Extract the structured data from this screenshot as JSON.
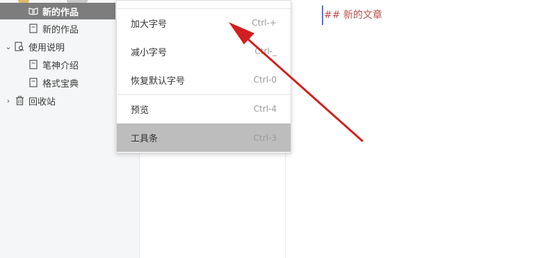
{
  "sidebar": {
    "items": [
      {
        "label": "新的作品",
        "icon": "book-open-icon",
        "selected": true
      },
      {
        "label": "新的作品",
        "icon": "document-icon"
      },
      {
        "label": "使用说明",
        "icon": "search-document-icon",
        "expanded": true
      },
      {
        "label": "笔神介绍",
        "icon": "document-icon"
      },
      {
        "label": "格式宝典",
        "icon": "document-icon"
      },
      {
        "label": "回收站",
        "icon": "trash-icon",
        "expanded": false
      }
    ]
  },
  "menu": {
    "items": [
      {
        "label": "加大字号",
        "shortcut": "Ctrl-+"
      },
      {
        "label": "减小字号",
        "shortcut": "Ctrl-_"
      },
      {
        "label": "恢复默认字号",
        "shortcut": "Ctrl-0"
      },
      {
        "label": "预览",
        "shortcut": "Ctrl-4"
      },
      {
        "label": "工具条",
        "shortcut": "Ctrl-3",
        "highlighted": true
      }
    ]
  },
  "editor": {
    "content": "## 新的文章"
  },
  "colors": {
    "accent": "#5b6fd6",
    "markdown_heading": "#c0504d",
    "annotation_arrow": "#d11f1f",
    "selected_bg": "#7d7d7d"
  }
}
